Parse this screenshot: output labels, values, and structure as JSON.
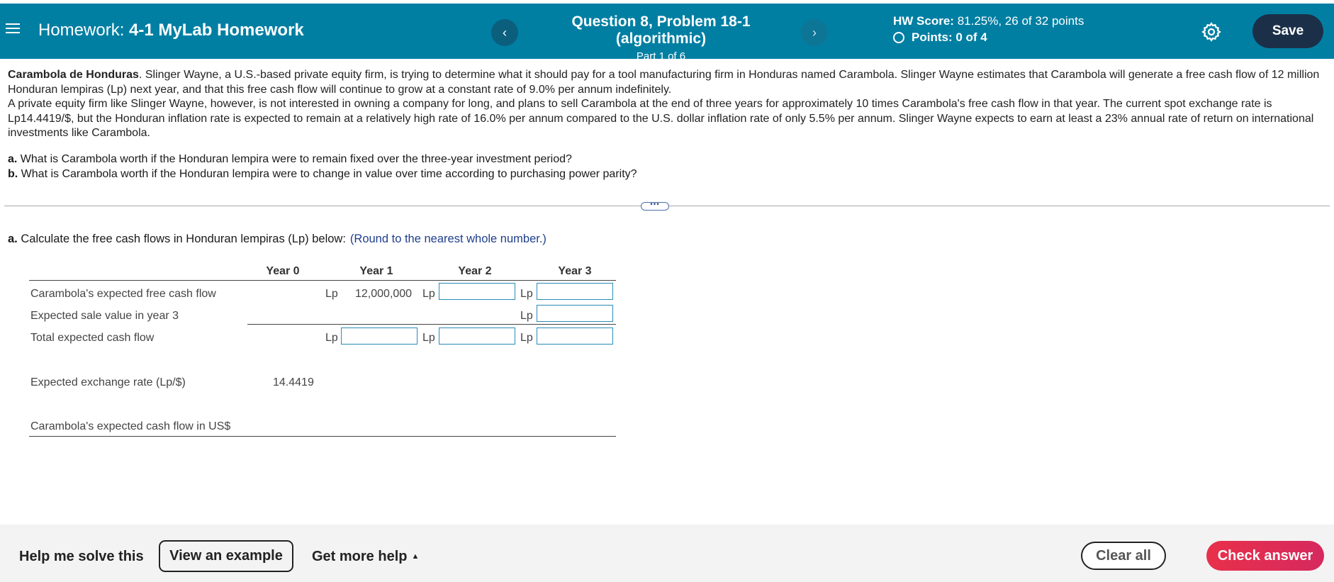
{
  "header": {
    "hw_prefix": "Homework:",
    "hw_name": "4-1 MyLab Homework",
    "question_title": "Question 8, Problem 18-1 (algorithmic)",
    "part": "Part 1 of 6",
    "score_label": "HW Score:",
    "score_value": "81.25%, 26 of 32 points",
    "points_label": "Points:",
    "points_value": "0 of 4",
    "save_label": "Save",
    "prev_glyph": "‹",
    "next_glyph": "›",
    "colors": {
      "bar": "#007fa3",
      "save": "#1b3048"
    }
  },
  "problem": {
    "company": "Carambola de Honduras",
    "para1": ". Slinger Wayne, a U.S.-based private equity firm, is trying to determine what it should pay for a tool manufacturing firm in Honduras named Carambola. Slinger Wayne estimates that Carambola will generate a free cash flow of 12 million Honduran lempiras (Lp) next year, and that this free cash flow will continue to grow at a constant rate of 9.0% per annum indefinitely.",
    "para2": "A private equity firm like Slinger Wayne, however, is not interested in owning a company for long, and plans to sell Carambola at the end of three years for approximately 10 times Carambola's free cash flow in that year. The current spot exchange rate is Lp14.4419/$, but the Honduran inflation rate is expected to remain at a relatively high rate of 16.0% per annum compared to the U.S. dollar inflation rate of only 5.5% per annum. Slinger Wayne expects to earn at least a 23% annual rate of return on international investments like Carambola.",
    "qa_letter": "a.",
    "qa_text": " What is Carambola worth if the Honduran lempira were to remain fixed over the three-year investment period?",
    "qb_letter": "b.",
    "qb_text": " What is Carambola worth if the Honduran lempira were to change in value over time according to purchasing power parity?"
  },
  "expander_glyph": "•••",
  "part_a": {
    "letter": "a.",
    "text": " Calculate the free cash flows in Honduran lempiras (Lp) below:",
    "hint": "(Round to the nearest whole number.)"
  },
  "table": {
    "columns": [
      "Year 0",
      "Year 1",
      "Year 2",
      "Year 3"
    ],
    "currency": "Lp",
    "rows": {
      "fcf": "Carambola's expected free cash flow",
      "sale": "Expected sale value in year 3",
      "total": "Total expected cash flow",
      "fx": "Expected exchange rate (Lp/$)",
      "usd": "Carambola's expected cash flow in US$"
    },
    "fcf_year1": "12,000,000",
    "fx_year0": "14.4419",
    "inputs": {
      "fcf_year2": "",
      "fcf_year3": "",
      "sale_year3": "",
      "total_year1": "",
      "total_year2": "",
      "total_year3": ""
    }
  },
  "footer": {
    "help_solve": "Help me solve this",
    "view_example": "View an example",
    "more_help": "Get more help",
    "more_help_glyph": "▲",
    "clear_all": "Clear all",
    "check_answer": "Check answer"
  }
}
